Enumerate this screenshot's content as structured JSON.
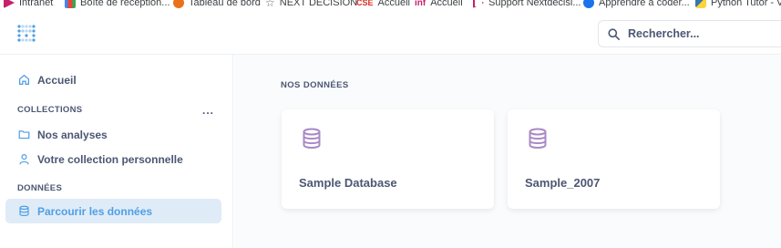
{
  "bookmarks": [
    {
      "label": "Intranet",
      "icon": "intranet-icon",
      "color": "#c4226b"
    },
    {
      "label": "Boîte de réception...",
      "icon": "gmail-icon",
      "color": "#d93025"
    },
    {
      "label": "Tableau de bord",
      "icon": "dashboard-icon",
      "color": "#e8711a"
    },
    {
      "label": "NEXT DECISION",
      "icon": "star-icon",
      "color": "#5f6368"
    },
    {
      "label": "Accueil",
      "icon": "cse-icon",
      "color": "#d93025"
    },
    {
      "label": "Accueil",
      "icon": "inf-icon",
      "color": "#c4226b"
    },
    {
      "label": "Support Nextdecisi...",
      "icon": "support-icon",
      "color": "#c4226b"
    },
    {
      "label": "Apprendre à coder...",
      "icon": "learn-icon",
      "color": "#1a73e8"
    },
    {
      "label": "Python Tutor - Vis",
      "icon": "python-icon",
      "color": "#3776ab"
    }
  ],
  "header": {
    "search_placeholder": "Rechercher..."
  },
  "sidebar": {
    "home_label": "Accueil",
    "collections_section": "COLLECTIONS",
    "collections_menu": "...",
    "collections": [
      {
        "label": "Nos analyses",
        "icon": "folder-icon"
      },
      {
        "label": "Votre collection personnelle",
        "icon": "person-icon"
      }
    ],
    "data_section": "DONNÉES",
    "browse_label": "Parcourir les données"
  },
  "main": {
    "title": "NOS DONNÉES",
    "databases": [
      {
        "label": "Sample Database",
        "icon": "database-icon"
      },
      {
        "label": "Sample_2007",
        "icon": "database-icon"
      }
    ]
  },
  "colors": {
    "brand": "#509ee3",
    "database_icon": "#a989c5",
    "active_bg": "#dfecf8",
    "text": "#4c5773"
  }
}
